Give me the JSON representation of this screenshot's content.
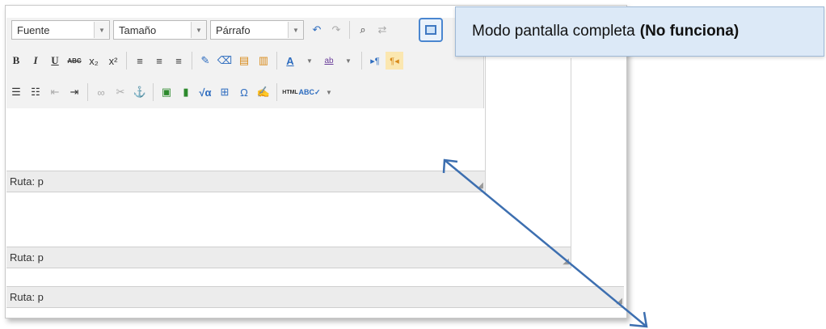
{
  "toolbar": {
    "font_select": "Fuente",
    "size_select": "Tamaño",
    "format_select": "Párrafo",
    "fullscreen_icon": "fullscreen-icon"
  },
  "status_bars": [
    {
      "label": "Ruta: p"
    },
    {
      "label": "Ruta: p"
    },
    {
      "label": "Ruta: p"
    }
  ],
  "callout": {
    "text": "Modo pantalla completa",
    "emphasis": "(No funciona)"
  },
  "colors": {
    "highlight_border": "#4a86d0",
    "callout_bg": "#dce9f7",
    "arrow": "#3d6fb0"
  }
}
